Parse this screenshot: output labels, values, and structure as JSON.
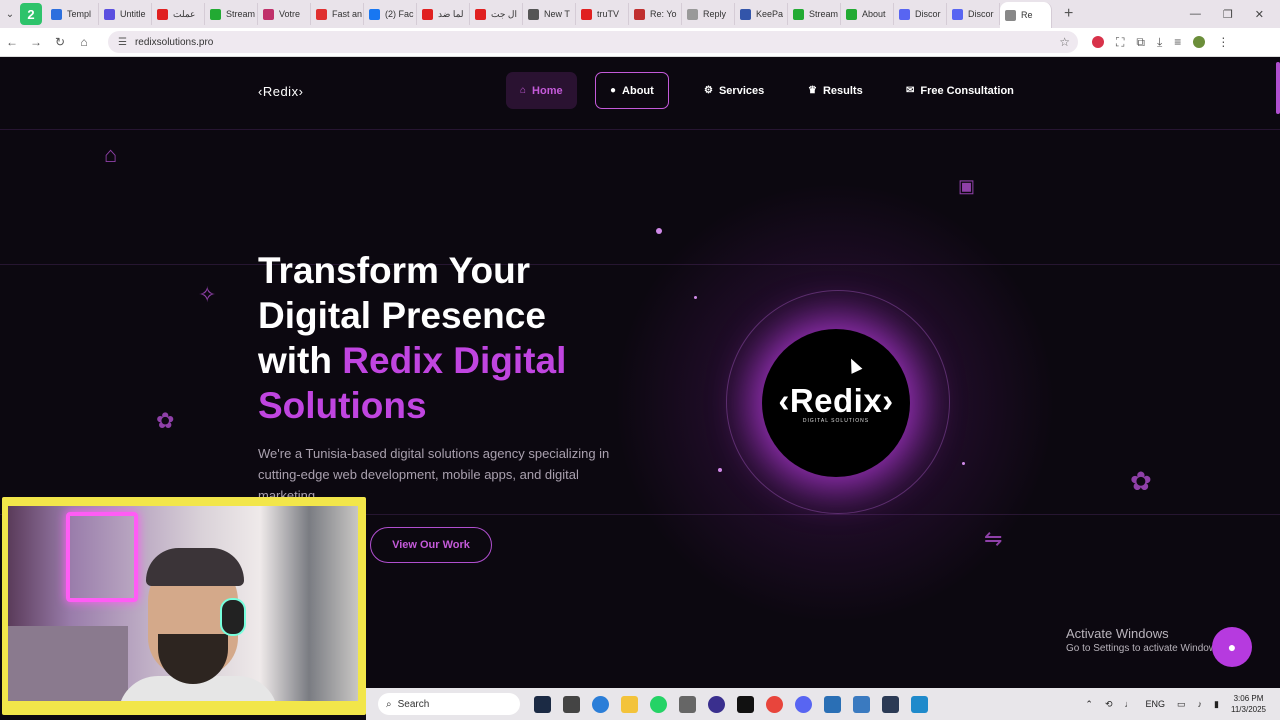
{
  "browser": {
    "tabs": [
      {
        "label": "Templ",
        "color": "#2c6fde"
      },
      {
        "label": "Untitle",
        "color": "#5b4fe0"
      },
      {
        "label": "عملت",
        "color": "#e02020"
      },
      {
        "label": "Stream",
        "color": "#22aa33"
      },
      {
        "label": "Votre",
        "color": "#c0306a"
      },
      {
        "label": "Fast an",
        "color": "#e03030"
      },
      {
        "label": "(2) Fac",
        "color": "#1877f2"
      },
      {
        "label": "لما ضد",
        "color": "#e02020"
      },
      {
        "label": "ال جت",
        "color": "#e02020"
      },
      {
        "label": "New T",
        "color": "#555555"
      },
      {
        "label": "truTV",
        "color": "#e02020"
      },
      {
        "label": "Re: Yo",
        "color": "#c03030"
      },
      {
        "label": "Reply",
        "color": "#999999"
      },
      {
        "label": "KeePa",
        "color": "#3355aa"
      },
      {
        "label": "Stream",
        "color": "#22aa33"
      },
      {
        "label": "About",
        "color": "#22aa33"
      },
      {
        "label": "Discor",
        "color": "#5865f2"
      },
      {
        "label": "Discor",
        "color": "#5865f2"
      },
      {
        "label": "Re",
        "color": "#888888"
      }
    ],
    "profile_badge": "2",
    "new_tab": "+",
    "url": "redixsolutions.pro"
  },
  "site": {
    "logo": "‹Redix›",
    "nav": {
      "home": "Home",
      "about": "About",
      "services": "Services",
      "results": "Results",
      "consultation": "Free Consultation"
    },
    "hero": {
      "title_line1": "Transform Your",
      "title_line2": "Digital Presence",
      "title_with": "with ",
      "title_accent": "Redix Digital Solutions",
      "subtitle": "We're a Tunisia-based digital solutions agency specializing in cutting-edge web development, mobile apps, and digital marketing.",
      "cta": "View Our Work"
    },
    "orb": {
      "logo": "‹Redix›",
      "tagline": "DIGITAL SOLUTIONS"
    },
    "accent_color": "#c045e0"
  },
  "windows_activation": {
    "title": "Activate Windows",
    "subtitle": "Go to Settings to activate Windows."
  },
  "taskbar": {
    "search_placeholder": "Search",
    "lang": "ENG",
    "time": "3:06 PM",
    "date": "11/3/2025"
  }
}
